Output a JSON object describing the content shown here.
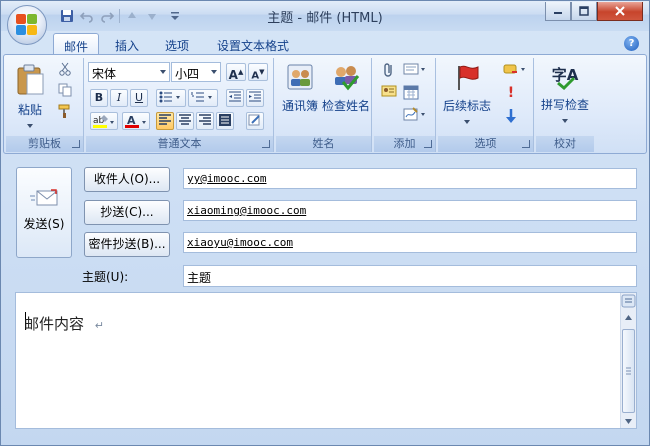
{
  "window": {
    "title": "主题 - 邮件 (HTML)",
    "controls": [
      "minimize",
      "maximize",
      "close"
    ]
  },
  "quick_access": {
    "icons": [
      "save-icon",
      "undo-icon",
      "redo-icon",
      "up-arrow-icon",
      "down-arrow-icon",
      "customize-icon"
    ]
  },
  "tabs": [
    {
      "label": "邮件",
      "active": true
    },
    {
      "label": "插入",
      "active": false
    },
    {
      "label": "选项",
      "active": false
    },
    {
      "label": "设置文本格式",
      "active": false
    }
  ],
  "ribbon": {
    "clipboard": {
      "group_label": "剪贴板",
      "paste_label": "粘贴"
    },
    "basic_text": {
      "group_label": "普通文本",
      "font_name": "宋体",
      "font_size": "小四",
      "grow_font": "A",
      "shrink_font": "A",
      "bold": "B",
      "italic": "I",
      "underline": "U"
    },
    "names": {
      "group_label": "姓名",
      "address_book": "通讯簿",
      "check_names": "检查姓名"
    },
    "include": {
      "group_label": "添加"
    },
    "options": {
      "group_label": "选项",
      "follow_up": "后续标志"
    },
    "proofing": {
      "group_label": "校对",
      "spelling": "拼写检查",
      "spelling_glyph": "字A"
    }
  },
  "compose": {
    "send_label": "发送(S)",
    "to_label": "收件人(O)...",
    "cc_label": "抄送(C)...",
    "bcc_label": "密件抄送(B)...",
    "subject_label": "主题(U):",
    "to_value": "yy@imooc.com",
    "cc_value": "xiaoming@imooc.com",
    "bcc_value": "xiaoyu@imooc.com",
    "subject_value": "主题",
    "body_text": "邮件内容",
    "paragraph_mark": "↵"
  },
  "colors": {
    "accent": "#15428b",
    "highlight": "#ffff00",
    "font_color": "#e00000",
    "flag": "#d8302a"
  }
}
